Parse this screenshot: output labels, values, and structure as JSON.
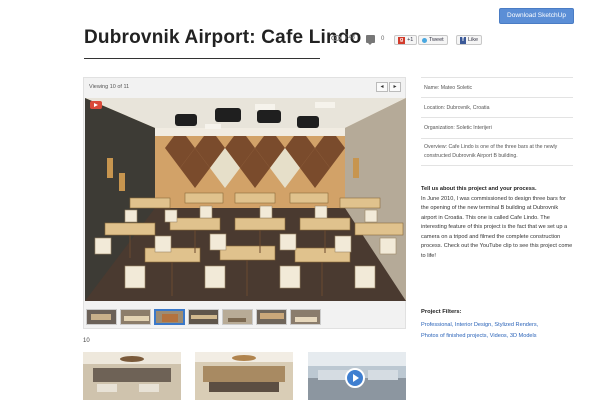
{
  "header": {
    "download_label": "Download SketchUp",
    "title": "Dubrovnik Airport: Cafe Lindo",
    "views": "748",
    "comments": "0",
    "share": {
      "google_label": "+1",
      "tweet_label": "Tweet",
      "like_label": "Like"
    }
  },
  "viewer": {
    "counter": "Viewing 10 of 11",
    "prev_icon": "chevron-left-icon",
    "next_icon": "chevron-right-icon",
    "thumb_count": 8,
    "active_thumb": 3
  },
  "gallery": {
    "label": "10"
  },
  "info": {
    "name": "Name: Mateo Soletic",
    "location": "Location: Dubrovnik, Croatia",
    "organization": "Organization: Soletic Interijeri",
    "overview": "Overview: Cafe Lindo is one of the three bars at the newly constructed Dubrovnik Airport B building."
  },
  "description": {
    "heading": "Tell us about this project and your process.",
    "body": "In June 2010, I was commissioned to design three bars for the opening of the new terminal B building at Dubrovnik airport in Croatia. This one is called Cafe Lindo. The interesting feature of this project is the fact that we set up a camera on a tripod and filmed the complete construction process. Check out the YouTube clip to see this project come to life!"
  },
  "filters": {
    "heading": "Project Filters:",
    "items": [
      "Professional",
      "Interior Design",
      "Stylized Renders",
      "Photos of finished projects",
      "Videos",
      "3D Models"
    ]
  },
  "colors": {
    "accent": "#5b8ed6",
    "link": "#2a63b8"
  }
}
